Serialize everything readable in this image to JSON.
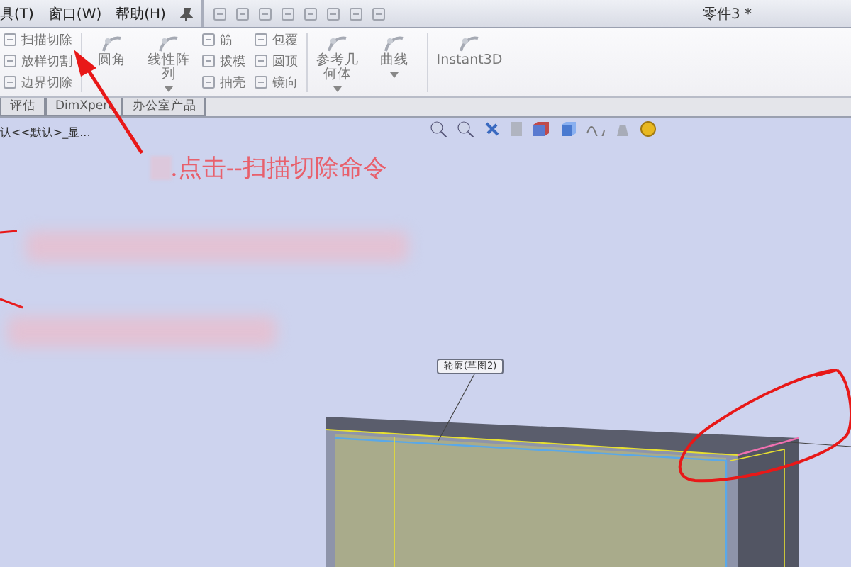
{
  "menu": [
    "具(T)",
    "窗口(W)",
    "帮助(H)"
  ],
  "window": {
    "title": "零件3 *"
  },
  "ribbon": [
    {
      "kind": "stack",
      "items": [
        {
          "label": "扫描切除"
        },
        {
          "label": "放样切割"
        },
        {
          "label": "边界切除"
        }
      ]
    },
    {
      "kind": "large",
      "label": "圆角",
      "caret": false
    },
    {
      "kind": "large",
      "label": "线性阵列",
      "caret": true
    },
    {
      "kind": "stack",
      "items": [
        {
          "label": "筋"
        },
        {
          "label": "拔模"
        },
        {
          "label": "抽壳"
        }
      ]
    },
    {
      "kind": "stack",
      "items": [
        {
          "label": "包覆"
        },
        {
          "label": "圆顶"
        },
        {
          "label": "镜向"
        }
      ]
    },
    {
      "kind": "large",
      "label": "参考几何体",
      "caret": true
    },
    {
      "kind": "large",
      "label": "曲线",
      "caret": true
    },
    {
      "kind": "large",
      "label": "Instant3D",
      "caret": false
    }
  ],
  "tabs": [
    "评估",
    "DimXpert",
    "办公室产品"
  ],
  "tree_text": "认<<默认>_显...",
  "annotation": {
    "step_text": ".点击--扫描切除命令"
  },
  "callout": "轮廓(草图2)"
}
